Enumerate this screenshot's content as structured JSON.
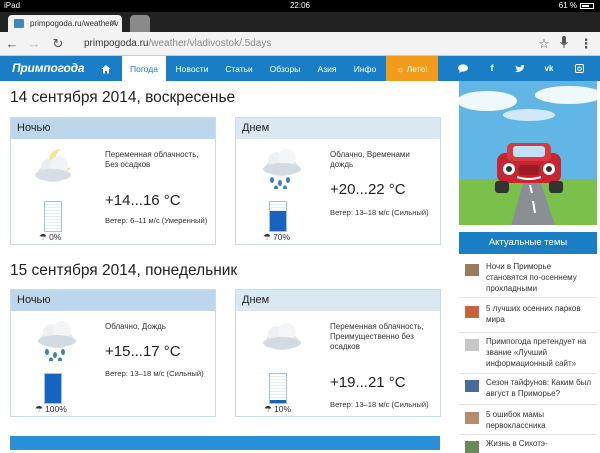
{
  "status": {
    "device": "iPad",
    "time": "22:06",
    "battery": "61 %"
  },
  "browser": {
    "tab_title": "primpogoda.ru/weather/v",
    "url_host": "primpogoda.ru",
    "url_path": "/weather/vladivostok/.5days"
  },
  "site": {
    "logo": "Примпогода",
    "nav": [
      {
        "label": "Погода",
        "active": true
      },
      {
        "label": "Новости"
      },
      {
        "label": "Статьи"
      },
      {
        "label": "Обзоры"
      },
      {
        "label": "Азия"
      },
      {
        "label": "Инфо"
      },
      {
        "label": "Лето!"
      }
    ],
    "social": [
      "speech-bubble-icon",
      "facebook-icon",
      "twitter-icon",
      "vk-icon",
      "instagram-icon"
    ]
  },
  "days": [
    {
      "title": "14 сентября 2014, воскресенье",
      "periods": [
        {
          "name": "Ночью",
          "icon": "cloud-moon-icon",
          "condition": "Переменная облачность, Без осадков",
          "temp": "+14...16 °C",
          "wind": "Ветер: 6–11 м/с (Умеренный)",
          "precip": "0%",
          "precip_level": 0
        },
        {
          "name": "Днем",
          "icon": "cloud-rain-icon",
          "condition": "Облачно, Временами дождь",
          "temp": "+20...22 °C",
          "wind": "Ветер: 13–18 м/с (Сильный)",
          "precip": "70%",
          "precip_level": 0.7
        }
      ]
    },
    {
      "title": "15 сентября 2014, понедельник",
      "periods": [
        {
          "name": "Ночью",
          "icon": "cloud-rain-icon",
          "condition": "Облачно, Дождь",
          "temp": "+15...17 °C",
          "wind": "Ветер: 13–18 м/с (Сильный)",
          "precip": "100%",
          "precip_level": 1
        },
        {
          "name": "Днем",
          "icon": "cloud-icon",
          "condition": "Переменная облачность, Преимущественно без осадков",
          "temp": "+19...21 °C",
          "wind": "Ветер: 13–18 м/с (Сильный)",
          "precip": "10%",
          "precip_level": 0.1
        }
      ]
    }
  ],
  "sidebar": {
    "hot_title": "Актуальные темы",
    "items": [
      "Ночи в Приморье становятся по-осеннему прохладными",
      "5 лучших осенних парков мира",
      "Примпогода претендует на звание «Лучший информационный сайт»",
      "Сезон тайфунов: Каким был август в Приморье?",
      "5 ошибок мамы первоклассника",
      "Жизнь в Сихотэ-"
    ]
  },
  "colors": {
    "brand": "#1a7ec6",
    "promo": "#f29b1b",
    "gauge": "#1565c0",
    "card_night": "#bcd7ec",
    "card_day": "#d9e8f3"
  }
}
